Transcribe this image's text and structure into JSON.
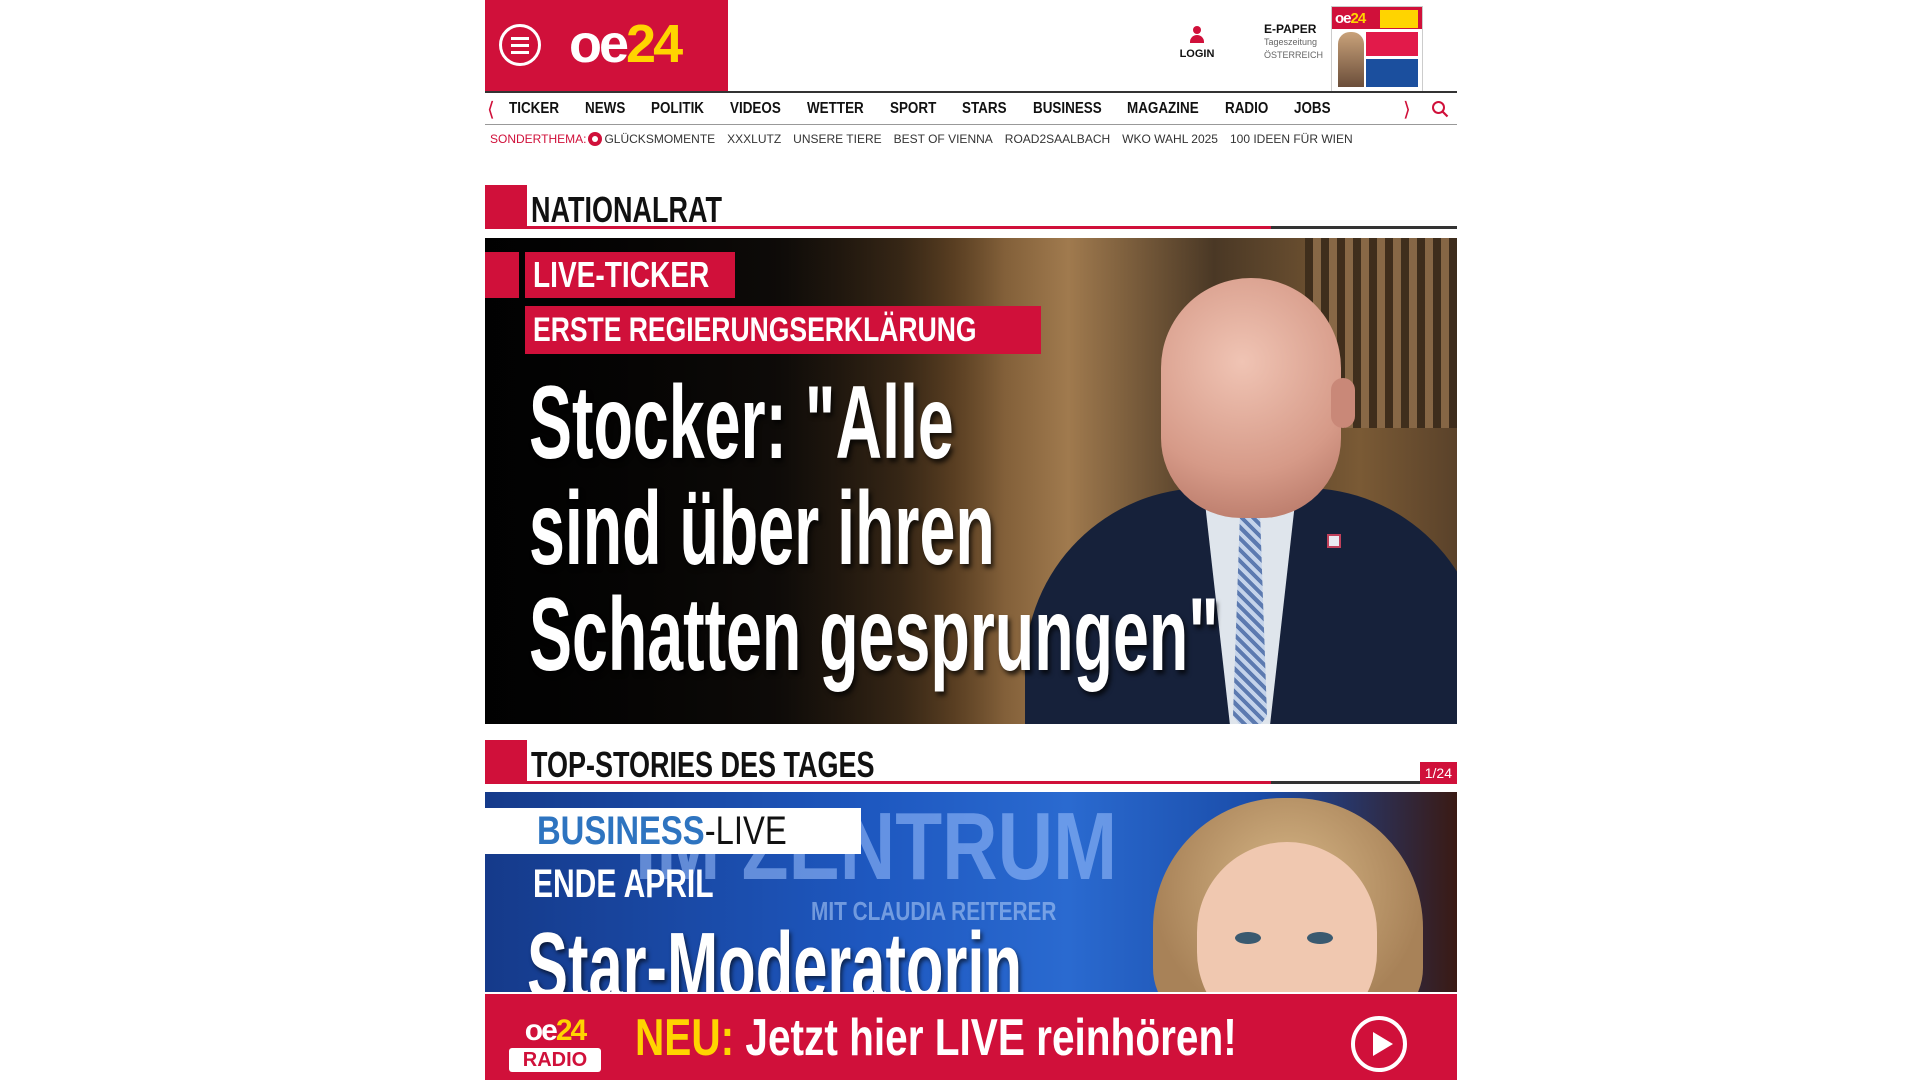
{
  "brand": {
    "logo_prefix": "oe",
    "logo_number": "24",
    "color_primary": "#d0103a",
    "color_accent": "#ffd400"
  },
  "header": {
    "menu_icon": "hamburger-menu-icon",
    "login_label": "LOGIN",
    "epaper": {
      "title": "E-PAPER",
      "line1": "Tageszeitung",
      "line2": "ÖSTERREICH"
    }
  },
  "nav": {
    "items": [
      "TICKER",
      "NEWS",
      "POLITIK",
      "VIDEOS",
      "WETTER",
      "SPORT",
      "STARS",
      "BUSINESS",
      "MAGAZINE",
      "RADIO",
      "JOBS"
    ],
    "prev_icon": "chevron-left-icon",
    "next_icon": "chevron-right-icon",
    "search_icon": "search-icon"
  },
  "subnav": {
    "label": "SONDERTHEMA:",
    "items": [
      "GLÜCKSMOMENTE",
      "XXXLUTZ",
      "UNSERE TIERE",
      "BEST OF VIENNA",
      "ROAD2SAALBACH",
      "WKO WAHL 2025",
      "100 IDEEN FÜR WIEN"
    ]
  },
  "section1": {
    "title": "NATIONALRAT"
  },
  "hero": {
    "tag1": "LIVE-TICKER",
    "tag2": "ERSTE REGIERUNGSERKLÄRUNG",
    "headline": [
      "Stocker: \"Alle",
      "sind über ihren",
      "Schatten gesprungen\""
    ]
  },
  "section2": {
    "title": "TOP-STORIES DES TAGES",
    "pager": "1/24"
  },
  "story2": {
    "badge_brand": "BUSINESS",
    "badge_live": "-LIVE",
    "bg_text": "IM ZENTRUM",
    "bg_sub": "MIT CLAUDIA REITERER",
    "kicker": "ENDE APRIL",
    "headline": "Star-Moderatorin"
  },
  "radio_banner": {
    "logo_prefix": "oe",
    "logo_number": "24",
    "logo_label": "RADIO",
    "neu": "NEU:",
    "message": "Jetzt hier LIVE reinhören!",
    "play_icon": "play-icon"
  }
}
